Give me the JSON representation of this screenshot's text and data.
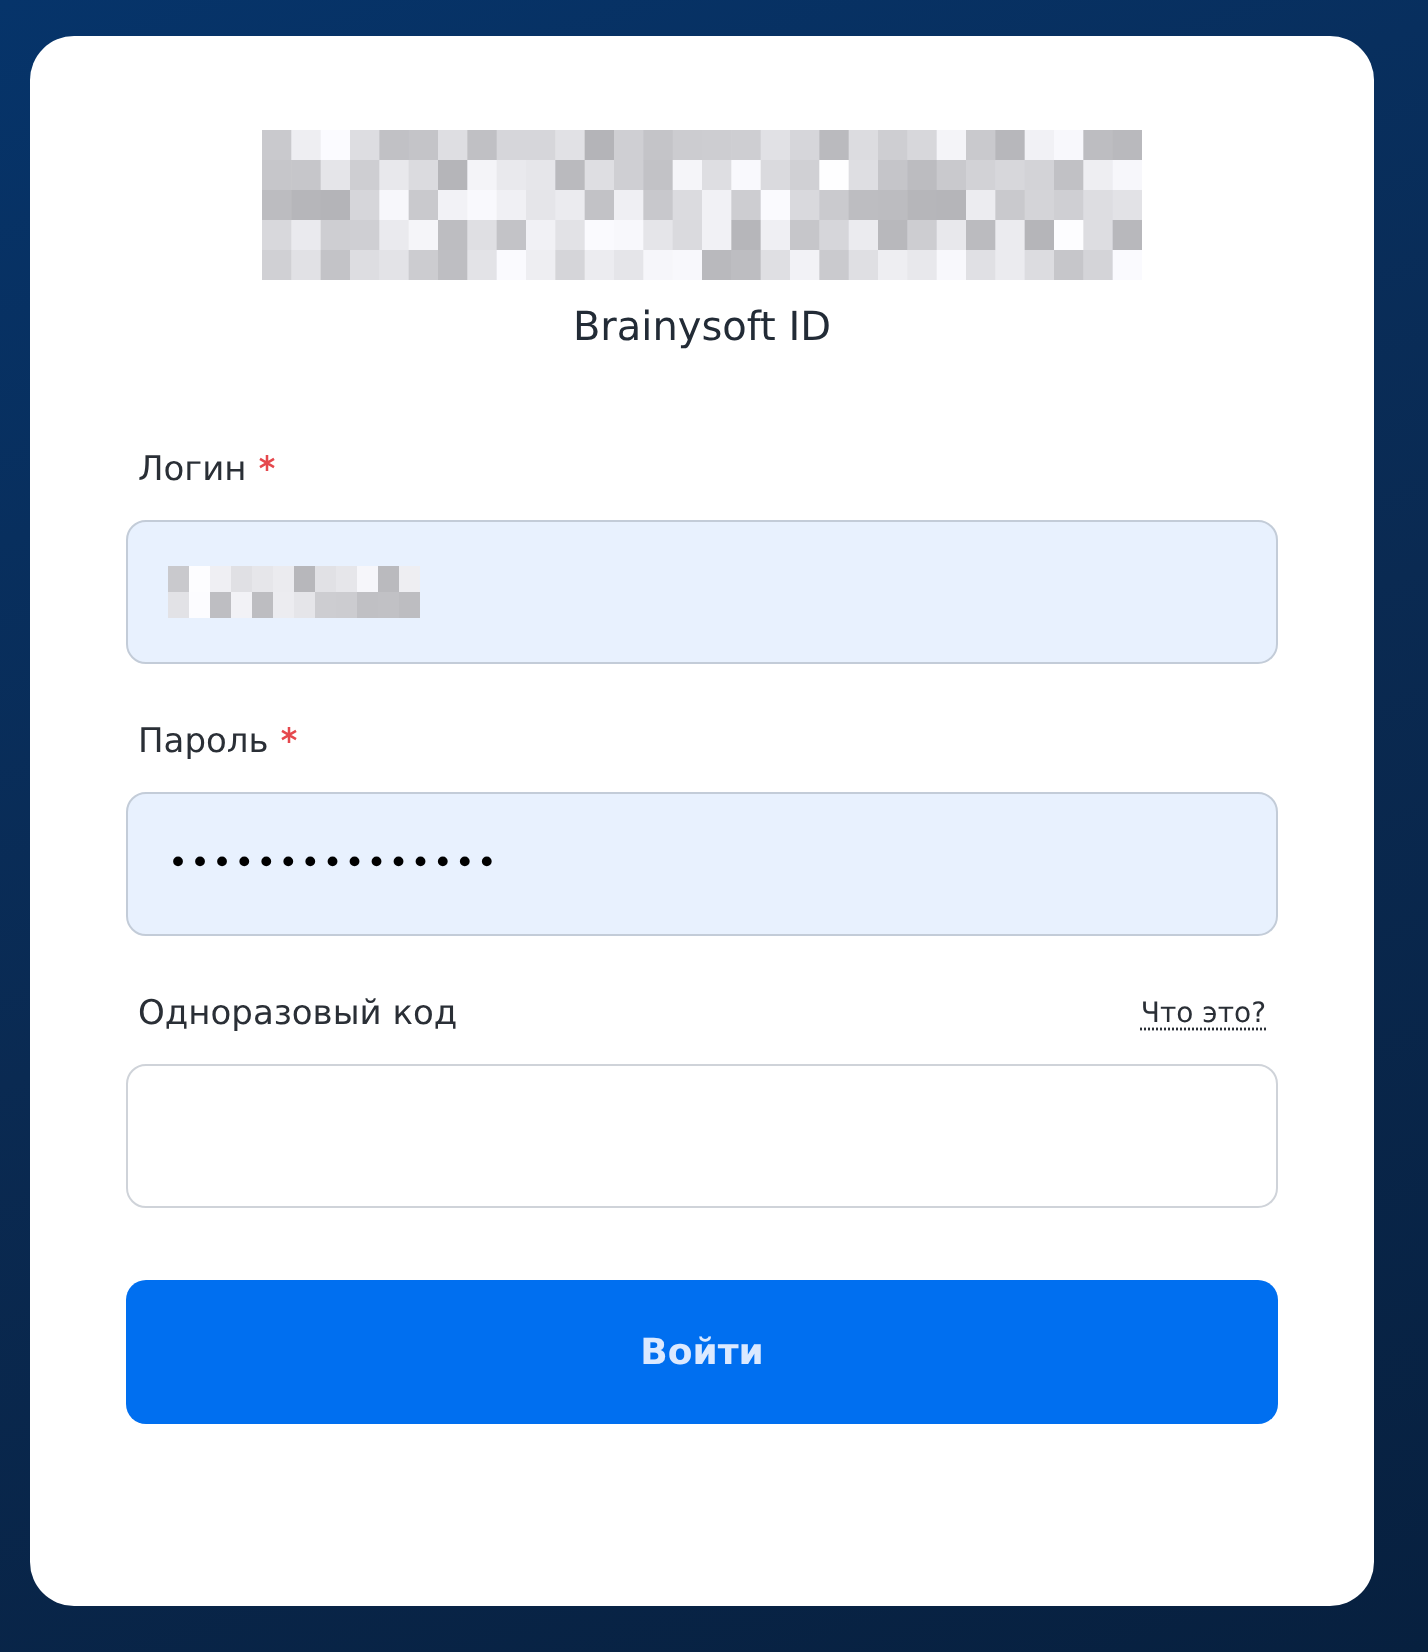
{
  "app": {
    "title": "Brainysoft ID"
  },
  "fields": [
    {
      "label": "Логин",
      "required": true,
      "kind": "redacted",
      "filled": true
    },
    {
      "label": "Пароль",
      "required": true,
      "kind": "password",
      "value": "•••••••••••••••",
      "filled": true
    },
    {
      "label": "Одноразовый код",
      "required": false,
      "kind": "text",
      "filled": false,
      "help_link": "Что это?"
    }
  ],
  "submit": {
    "label": "Войти"
  }
}
